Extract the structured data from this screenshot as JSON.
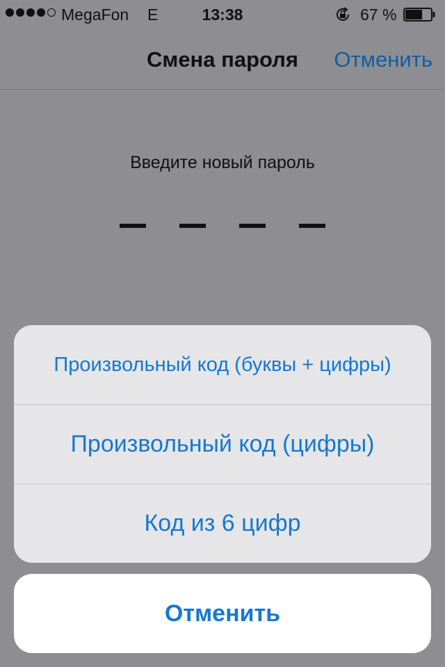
{
  "status_bar": {
    "carrier": "MegaFon",
    "network": "E",
    "time": "13:38",
    "battery_percent": "67 %",
    "signal_filled": 4,
    "signal_total": 5,
    "lock_icon": "rotation-lock-icon",
    "battery_icon": "battery-icon",
    "battery_level": 0.67
  },
  "nav": {
    "title": "Смена пароля",
    "cancel_label": "Отменить"
  },
  "passcode": {
    "prompt": "Введите новый пароль",
    "digits": 4
  },
  "action_sheet": {
    "options": [
      {
        "label": "Произвольный код (буквы + цифры)"
      },
      {
        "label": "Произвольный код (цифры)"
      },
      {
        "label": "Код из 6 цифр"
      }
    ],
    "cancel_label": "Отменить"
  },
  "colors": {
    "accent": "#1578d0",
    "dimmed_background": "#8e8d92"
  }
}
